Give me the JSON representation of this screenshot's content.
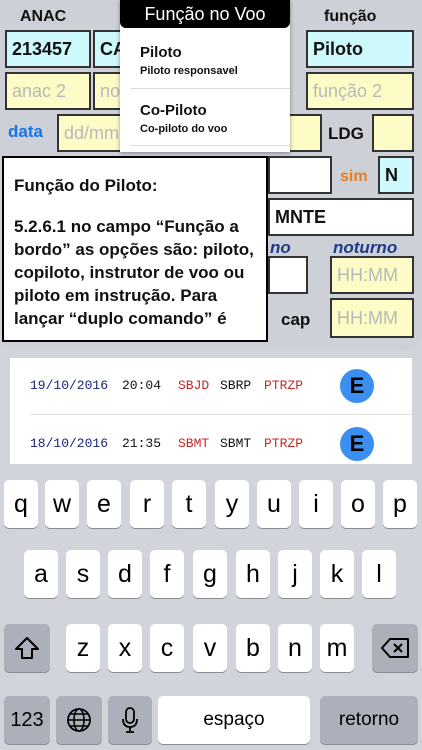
{
  "header": {
    "anac_label": "ANAC",
    "funcao_label": "função"
  },
  "form": {
    "anac1_value": "213457",
    "ca_value": "CA",
    "funcao1_value": "Piloto",
    "anac2_placeholder": "anac 2",
    "no_placeholder": "no",
    "funcao2_placeholder": "função 2",
    "data_label": "data",
    "date_placeholder": "dd/mm",
    "m_fragment": "m",
    "ldg_label": "LDG",
    "sim_label": "sim",
    "sim_value": "N",
    "mnte_value": "MNTE",
    "no_label": "no",
    "noturno_label": "noturno",
    "noturno_placeholder": "HH:MM",
    "cap_label": "cap",
    "cap_placeholder": "HH:MM"
  },
  "popover": {
    "title": "Função no Voo",
    "items": [
      {
        "label": "Piloto",
        "sublabel": "Piloto responsavel"
      },
      {
        "label": "Co-Piloto",
        "sublabel": "Co-piloto do voo"
      }
    ]
  },
  "help": {
    "title": "Função do Piloto:",
    "body": "5.2.6.1 no campo “Função a bordo” as opções são: piloto, copiloto, instrutor de voo ou piloto em instrução. Para lançar “duplo comando” é"
  },
  "log_rows": [
    {
      "date": "19/10/2016",
      "time": "20:04",
      "from": "SBJD",
      "to": "SBRP",
      "aircraft": "PTRZP",
      "button": "E"
    },
    {
      "date": "18/10/2016",
      "time": "21:35",
      "from": "SBMT",
      "to": "SBMT",
      "aircraft": "PTRZP",
      "button": "E"
    }
  ],
  "keyboard": {
    "row1": [
      "q",
      "w",
      "e",
      "r",
      "t",
      "y",
      "u",
      "i",
      "o",
      "p"
    ],
    "row2": [
      "a",
      "s",
      "d",
      "f",
      "g",
      "h",
      "j",
      "k",
      "l"
    ],
    "row3": [
      "z",
      "x",
      "c",
      "v",
      "b",
      "n",
      "m"
    ],
    "numbers_label": "123",
    "space_label": "espaço",
    "return_label": "retorno"
  },
  "colors": {
    "blue_label": "#1a73e8",
    "orange_label": "#e67e22",
    "date_blue": "#1a237e",
    "airport_red": "#c62828"
  }
}
